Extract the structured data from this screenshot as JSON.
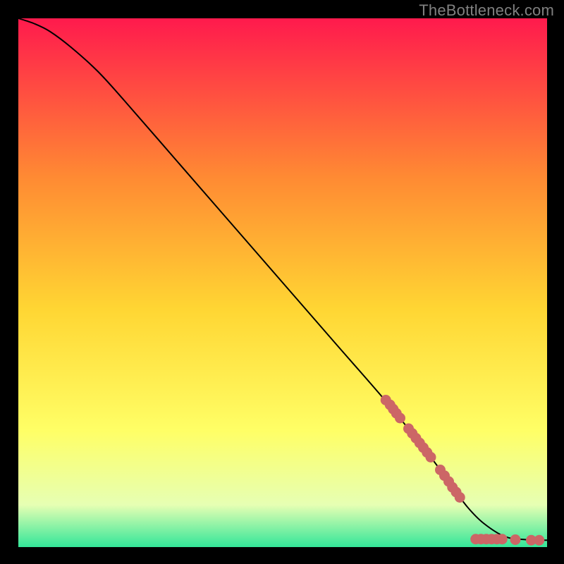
{
  "watermark": "TheBottleneck.com",
  "colors": {
    "top": "#ff1a4d",
    "midUpper": "#ff8a33",
    "mid": "#ffd633",
    "midLower": "#ffff66",
    "lower": "#e6ffb3",
    "bottom": "#33e699",
    "curve": "#000000",
    "dot": "#cc6666"
  },
  "chart_data": {
    "type": "line",
    "title": "",
    "xlabel": "",
    "ylabel": "",
    "xlim": [
      0,
      100
    ],
    "ylim": [
      0,
      100
    ],
    "series": [
      {
        "name": "curve",
        "x": [
          0,
          3,
          6,
          10,
          15,
          20,
          30,
          40,
          50,
          60,
          70,
          78,
          82,
          85,
          88,
          92,
          96,
          100
        ],
        "y": [
          100,
          99,
          97.5,
          94.5,
          90,
          84.5,
          73,
          61.5,
          50,
          38.5,
          27,
          17,
          11.5,
          7.5,
          4.5,
          2,
          1.4,
          1.3
        ]
      }
    ],
    "points": [
      {
        "name": "cluster",
        "x": 69.5,
        "y": 27.8
      },
      {
        "name": "cluster",
        "x": 70.3,
        "y": 26.9
      },
      {
        "name": "cluster",
        "x": 70.9,
        "y": 26.1
      },
      {
        "name": "cluster",
        "x": 71.5,
        "y": 25.3
      },
      {
        "name": "cluster",
        "x": 72.2,
        "y": 24.4
      },
      {
        "name": "cluster",
        "x": 73.8,
        "y": 22.4
      },
      {
        "name": "cluster",
        "x": 74.5,
        "y": 21.5
      },
      {
        "name": "cluster",
        "x": 75.2,
        "y": 20.6
      },
      {
        "name": "cluster",
        "x": 75.9,
        "y": 19.7
      },
      {
        "name": "cluster",
        "x": 76.6,
        "y": 18.8
      },
      {
        "name": "cluster",
        "x": 77.3,
        "y": 17.9
      },
      {
        "name": "cluster",
        "x": 78.0,
        "y": 17.0
      },
      {
        "name": "cluster",
        "x": 79.8,
        "y": 14.6
      },
      {
        "name": "cluster",
        "x": 80.6,
        "y": 13.5
      },
      {
        "name": "cluster",
        "x": 81.4,
        "y": 12.4
      },
      {
        "name": "cluster",
        "x": 82.1,
        "y": 11.3
      },
      {
        "name": "cluster",
        "x": 82.8,
        "y": 10.4
      },
      {
        "name": "cluster",
        "x": 83.5,
        "y": 9.4
      },
      {
        "name": "tail",
        "x": 86.5,
        "y": 1.5
      },
      {
        "name": "tail",
        "x": 87.5,
        "y": 1.5
      },
      {
        "name": "tail",
        "x": 88.5,
        "y": 1.5
      },
      {
        "name": "tail",
        "x": 89.5,
        "y": 1.5
      },
      {
        "name": "tail",
        "x": 90.5,
        "y": 1.5
      },
      {
        "name": "tail",
        "x": 91.5,
        "y": 1.5
      },
      {
        "name": "tail",
        "x": 94.0,
        "y": 1.4
      },
      {
        "name": "tail",
        "x": 97.0,
        "y": 1.3
      },
      {
        "name": "tail",
        "x": 98.5,
        "y": 1.3
      }
    ]
  }
}
